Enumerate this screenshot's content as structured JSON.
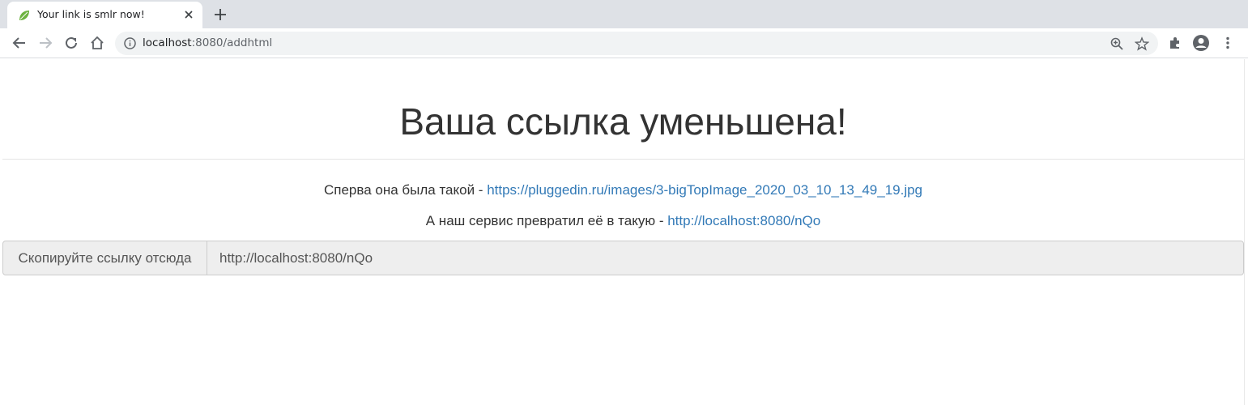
{
  "browser": {
    "tab": {
      "title": "Your link is smlr now!",
      "favicon": "spring-leaf-icon"
    },
    "address": {
      "host": "localhost",
      "rest": ":8080/addhtml"
    },
    "icons": [
      "back-icon",
      "forward-icon",
      "reload-icon",
      "home-icon",
      "info-icon",
      "zoom-icon",
      "star-icon",
      "extensions-icon",
      "profile-icon",
      "menu-icon"
    ]
  },
  "page": {
    "heading": "Ваша ссылка уменьшена!",
    "original_prefix": "Сперва она была такой - ",
    "original_url": "https://pluggedin.ru/images/3-bigTopImage_2020_03_10_13_49_19.jpg",
    "short_prefix": "А наш сервис превратил её в такую - ",
    "short_url": "http://localhost:8080/nQo",
    "copy_label": "Скопируйте ссылку отсюда",
    "copy_value": "http://localhost:8080/nQo"
  },
  "colors": {
    "link": "#337ab7",
    "text": "#333333",
    "tabstrip": "#dee1e6"
  }
}
